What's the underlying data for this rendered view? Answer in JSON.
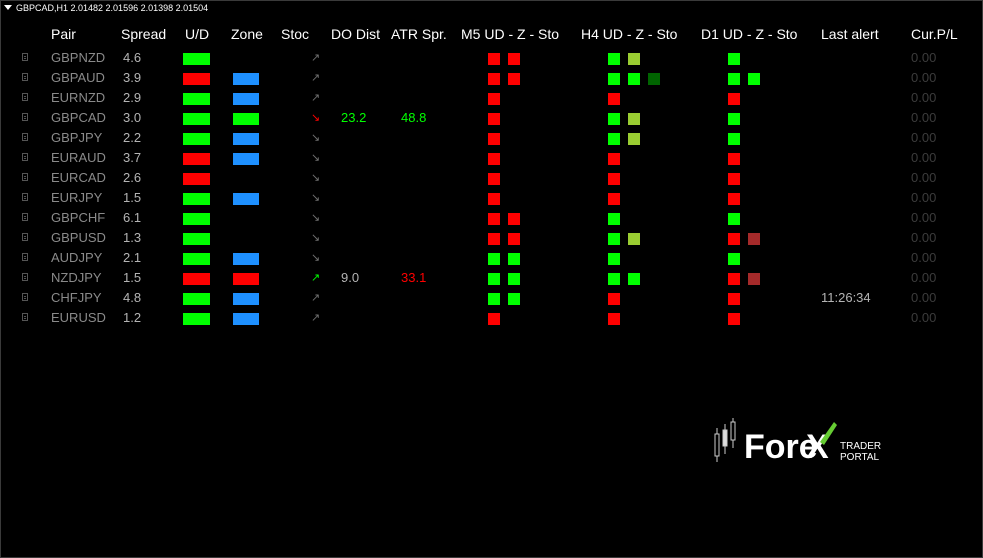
{
  "title_bar": "GBPCAD,H1  2.01482 2.01596 2.01398 2.01504",
  "headers": {
    "pair": "Pair",
    "spread": "Spread",
    "ud": "U/D",
    "zone": "Zone",
    "stoc": "Stoc",
    "do_dist": "DO Dist",
    "atr_spr": "ATR Spr.",
    "m5": "M5 UD - Z - Sto",
    "h4": "H4 UD - Z - Sto",
    "d1": "D1 UD - Z - Sto",
    "last_alert": "Last alert",
    "cur_pl": "Cur.P/L"
  },
  "colors": {
    "green": "#00ff00",
    "red": "#ff0000",
    "blue": "#1e90ff",
    "olive": "#9acd32",
    "dark_green": "#006400",
    "dark_red": "#a52a2a",
    "stoc_gray": "#707070"
  },
  "rows": [
    {
      "pair": "GBPNZD",
      "spread": "4.6",
      "ud": "green",
      "zone": "",
      "stoc": "↗",
      "stoc_color": "gray",
      "do_dist": "",
      "do_dist_color": "",
      "atr": "",
      "atr_color": "",
      "m5": [
        "red",
        "red"
      ],
      "h4": [
        "green",
        "olive"
      ],
      "d1": [
        "green"
      ],
      "last_alert": "",
      "pl": "0.00"
    },
    {
      "pair": "GBPAUD",
      "spread": "3.9",
      "ud": "red",
      "zone": "blue",
      "stoc": "↗",
      "stoc_color": "gray",
      "do_dist": "",
      "do_dist_color": "",
      "atr": "",
      "atr_color": "",
      "m5": [
        "red",
        "red"
      ],
      "h4": [
        "green",
        "green",
        "dark_green"
      ],
      "d1": [
        "green",
        "green"
      ],
      "last_alert": "",
      "pl": "0.00"
    },
    {
      "pair": "EURNZD",
      "spread": "2.9",
      "ud": "green",
      "zone": "blue",
      "stoc": "↗",
      "stoc_color": "gray",
      "do_dist": "",
      "do_dist_color": "",
      "atr": "",
      "atr_color": "",
      "m5": [
        "red"
      ],
      "h4": [
        "red"
      ],
      "d1": [
        "red"
      ],
      "last_alert": "",
      "pl": "0.00"
    },
    {
      "pair": "GBPCAD",
      "spread": "3.0",
      "ud": "green",
      "zone": "green",
      "stoc": "↘",
      "stoc_color": "red",
      "do_dist": "23.2",
      "do_dist_color": "green",
      "atr": "48.8",
      "atr_color": "green",
      "m5": [
        "red"
      ],
      "h4": [
        "green",
        "olive"
      ],
      "d1": [
        "green"
      ],
      "last_alert": "",
      "pl": "0.00"
    },
    {
      "pair": "GBPJPY",
      "spread": "2.2",
      "ud": "green",
      "zone": "blue",
      "stoc": "↘",
      "stoc_color": "gray",
      "do_dist": "",
      "do_dist_color": "",
      "atr": "",
      "atr_color": "",
      "m5": [
        "red"
      ],
      "h4": [
        "green",
        "olive"
      ],
      "d1": [
        "green"
      ],
      "last_alert": "",
      "pl": "0.00"
    },
    {
      "pair": "EURAUD",
      "spread": "3.7",
      "ud": "red",
      "zone": "blue",
      "stoc": "↘",
      "stoc_color": "gray",
      "do_dist": "",
      "do_dist_color": "",
      "atr": "",
      "atr_color": "",
      "m5": [
        "red"
      ],
      "h4": [
        "red"
      ],
      "d1": [
        "red"
      ],
      "last_alert": "",
      "pl": "0.00"
    },
    {
      "pair": "EURCAD",
      "spread": "2.6",
      "ud": "red",
      "zone": "",
      "stoc": "↘",
      "stoc_color": "gray",
      "do_dist": "",
      "do_dist_color": "",
      "atr": "",
      "atr_color": "",
      "m5": [
        "red"
      ],
      "h4": [
        "red"
      ],
      "d1": [
        "red"
      ],
      "last_alert": "",
      "pl": "0.00"
    },
    {
      "pair": "EURJPY",
      "spread": "1.5",
      "ud": "green",
      "zone": "blue",
      "stoc": "↘",
      "stoc_color": "gray",
      "do_dist": "",
      "do_dist_color": "",
      "atr": "",
      "atr_color": "",
      "m5": [
        "red"
      ],
      "h4": [
        "red"
      ],
      "d1": [
        "red"
      ],
      "last_alert": "",
      "pl": "0.00"
    },
    {
      "pair": "GBPCHF",
      "spread": "6.1",
      "ud": "green",
      "zone": "",
      "stoc": "↘",
      "stoc_color": "gray",
      "do_dist": "",
      "do_dist_color": "",
      "atr": "",
      "atr_color": "",
      "m5": [
        "red",
        "red"
      ],
      "h4": [
        "green"
      ],
      "d1": [
        "green"
      ],
      "last_alert": "",
      "pl": "0.00"
    },
    {
      "pair": "GBPUSD",
      "spread": "1.3",
      "ud": "green",
      "zone": "",
      "stoc": "↘",
      "stoc_color": "gray",
      "do_dist": "",
      "do_dist_color": "",
      "atr": "",
      "atr_color": "",
      "m5": [
        "red",
        "red"
      ],
      "h4": [
        "green",
        "olive"
      ],
      "d1": [
        "red",
        "dark_red"
      ],
      "last_alert": "",
      "pl": "0.00"
    },
    {
      "pair": "AUDJPY",
      "spread": "2.1",
      "ud": "green",
      "zone": "blue",
      "stoc": "↘",
      "stoc_color": "gray",
      "do_dist": "",
      "do_dist_color": "",
      "atr": "",
      "atr_color": "",
      "m5": [
        "green",
        "green"
      ],
      "h4": [
        "green"
      ],
      "d1": [
        "green"
      ],
      "last_alert": "",
      "pl": "0.00"
    },
    {
      "pair": "NZDJPY",
      "spread": "1.5",
      "ud": "red",
      "zone": "red",
      "stoc": "↗",
      "stoc_color": "green",
      "do_dist": "9.0",
      "do_dist_color": "gray",
      "atr": "33.1",
      "atr_color": "red",
      "m5": [
        "green",
        "green"
      ],
      "h4": [
        "green",
        "green"
      ],
      "d1": [
        "red",
        "dark_red"
      ],
      "last_alert": "",
      "pl": "0.00"
    },
    {
      "pair": "CHFJPY",
      "spread": "4.8",
      "ud": "green",
      "zone": "blue",
      "stoc": "↗",
      "stoc_color": "gray",
      "do_dist": "",
      "do_dist_color": "",
      "atr": "",
      "atr_color": "",
      "m5": [
        "green",
        "green"
      ],
      "h4": [
        "red"
      ],
      "d1": [
        "red"
      ],
      "last_alert": "11:26:34",
      "pl": "0.00"
    },
    {
      "pair": "EURUSD",
      "spread": "1.2",
      "ud": "green",
      "zone": "blue",
      "stoc": "↗",
      "stoc_color": "gray",
      "do_dist": "",
      "do_dist_color": "",
      "atr": "",
      "atr_color": "",
      "m5": [
        "red"
      ],
      "h4": [
        "red"
      ],
      "d1": [
        "red"
      ],
      "last_alert": "",
      "pl": "0.00"
    }
  ],
  "logo": {
    "word": "Fore",
    "x_letter": "X",
    "trader": "TRADER",
    "portal": "PORTAL"
  }
}
